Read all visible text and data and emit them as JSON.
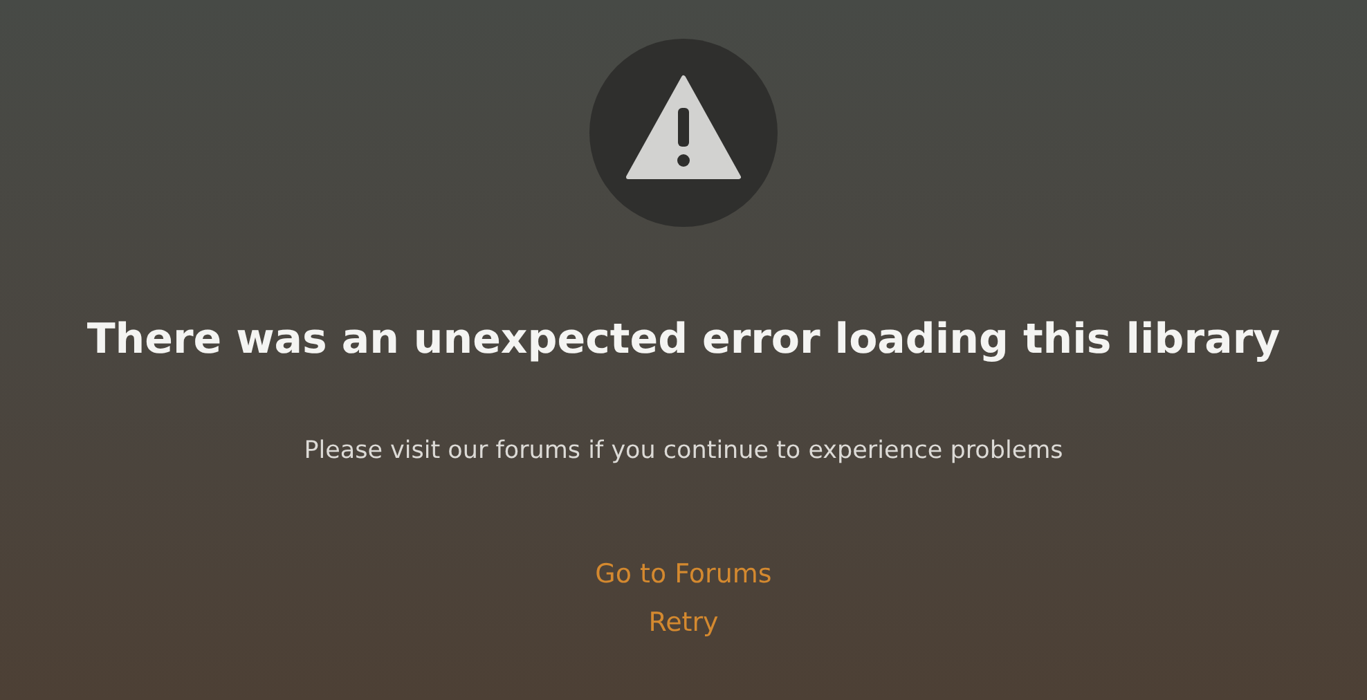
{
  "title": "There was an unexpected error loading this library",
  "message": "Please visit our forums if you continue to experience problems",
  "actions": [
    "Go to Forums",
    "Retry"
  ]
}
